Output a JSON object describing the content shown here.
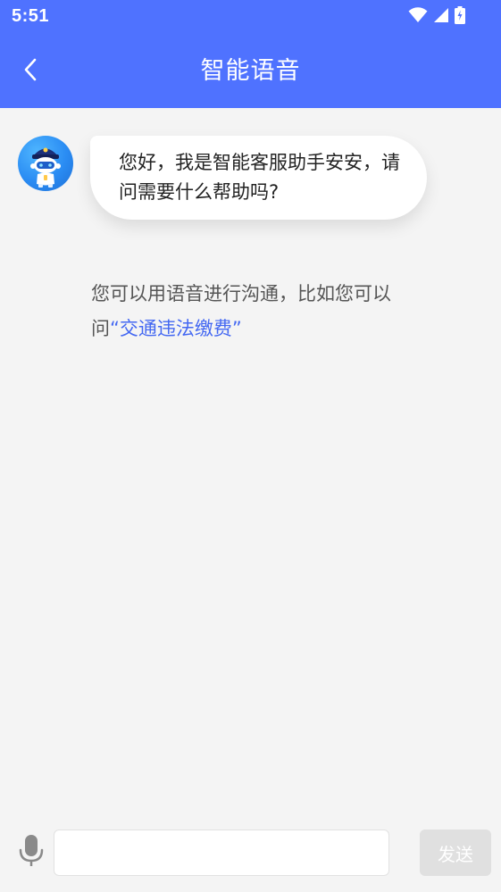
{
  "status_bar": {
    "time": "5:51",
    "icons": [
      "wifi-icon",
      "signal-icon",
      "battery-charging-icon"
    ]
  },
  "header": {
    "back_icon": "chevron-left-icon",
    "title": "智能语音"
  },
  "conversation": {
    "assistant_avatar": "robot-police-avatar",
    "greeting": "您好，我是智能客服助手安安，请问需要什么帮助吗?",
    "hint_prefix": "您可以用语音进行沟通，比如您可以问",
    "hint_example": "“交通违法缴费”"
  },
  "input_bar": {
    "mic_icon": "microphone-icon",
    "input_value": "",
    "input_placeholder": "",
    "send_label": "发送"
  },
  "colors": {
    "primary": "#4f72ff",
    "link": "#4468f2",
    "background": "#f4f4f4",
    "send_disabled": "#e0e0e0"
  }
}
